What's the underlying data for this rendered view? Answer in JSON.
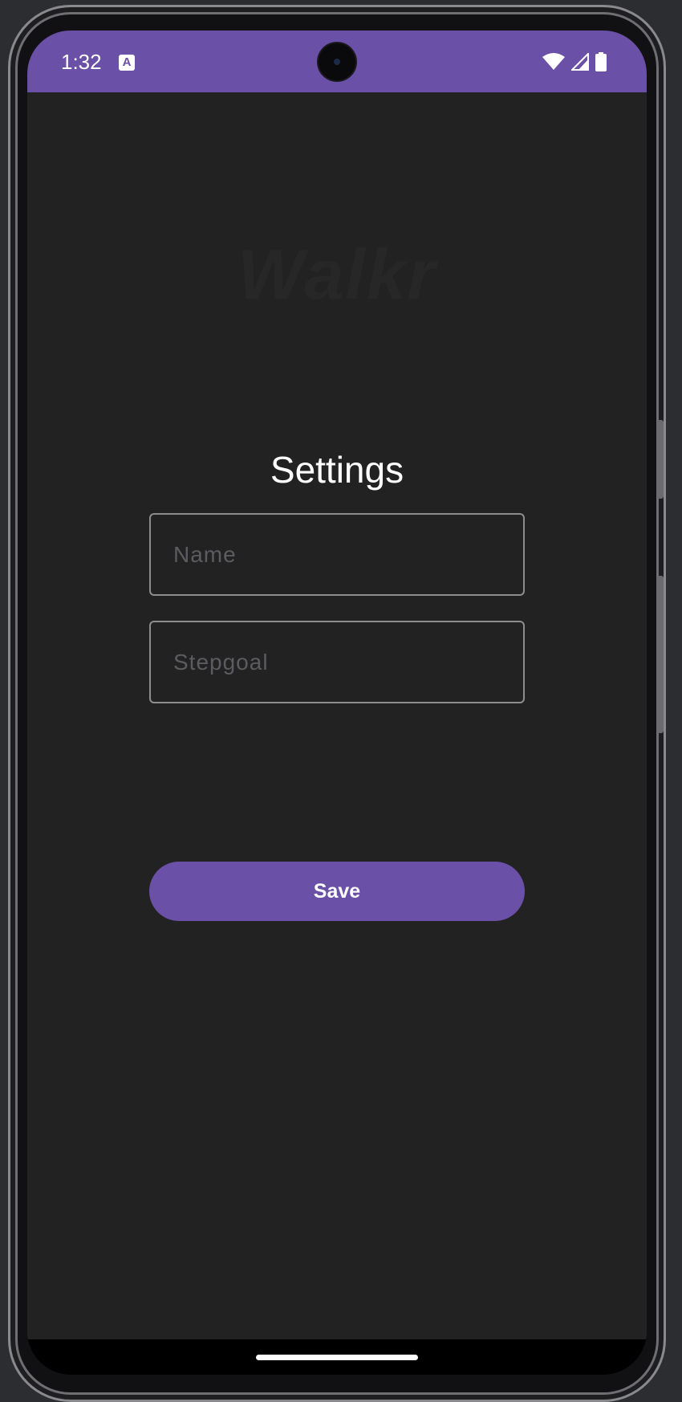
{
  "status_bar": {
    "time": "1:32",
    "app_icon": "A",
    "icons": [
      "wifi-icon",
      "cell-signal-icon",
      "battery-icon"
    ],
    "background_color": "#6a50a6"
  },
  "app": {
    "logo_text": "Walkr",
    "title": "Settings",
    "accent_color": "#6a50a6",
    "background_color": "#222222"
  },
  "form": {
    "name_placeholder": "Name",
    "name_value": "",
    "stepgoal_placeholder": "Stepgoal",
    "stepgoal_value": "",
    "save_label": "Save"
  }
}
